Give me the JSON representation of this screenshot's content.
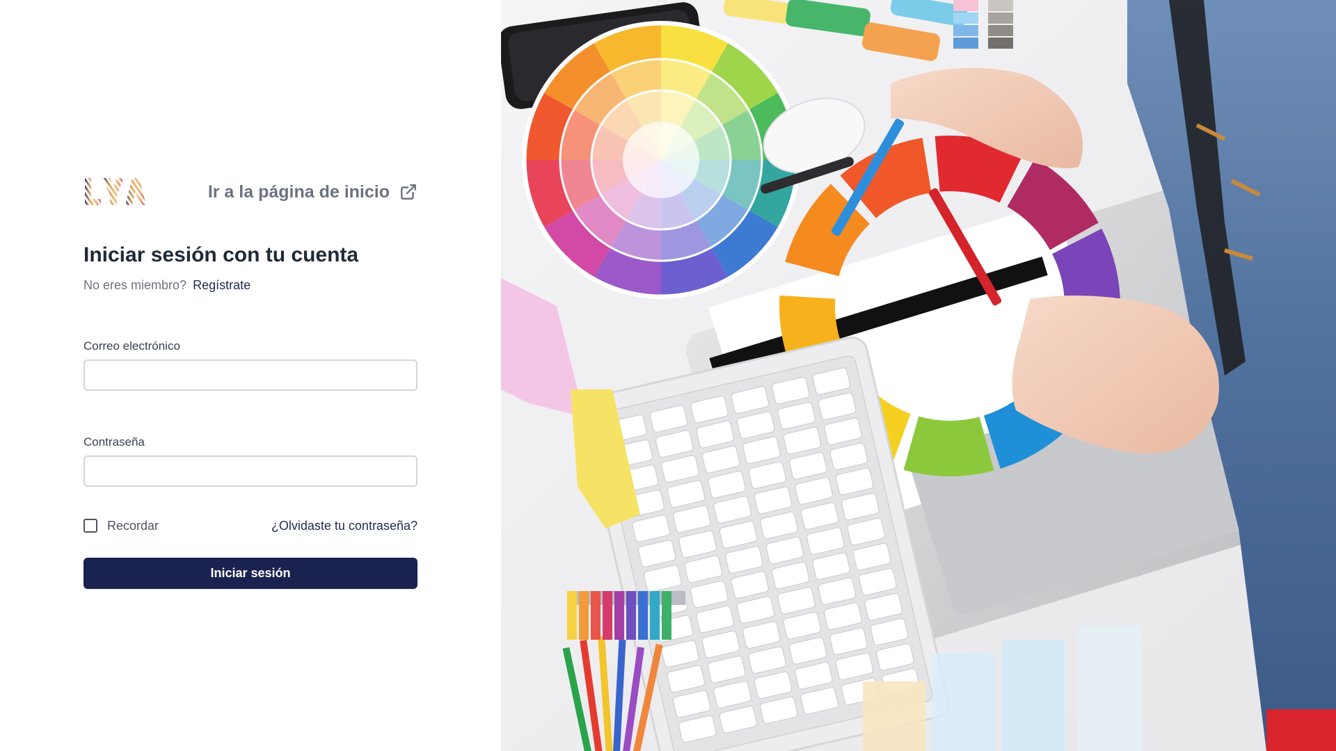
{
  "header": {
    "logo_text": "LYA",
    "home_link": "Ir a la página de inicio",
    "external_icon": "external-link-icon"
  },
  "login": {
    "title": "Iniciar sesión con tu cuenta",
    "not_member": "No eres miembro?",
    "register_link": "Regístrate",
    "email_label": "Correo electrónico",
    "email_value": "",
    "password_label": "Contraseña",
    "password_value": "",
    "remember_label": "Recordar",
    "remember_checked": false,
    "forgot_link": "¿Olvidaste tu contraseña?",
    "submit_label": "Iniciar sesión"
  },
  "hero": {
    "description_icon": "designer-desk-photo"
  },
  "colors": {
    "primary_button": "#1a2350",
    "link": "#1e2a4f",
    "muted_text": "#6b7280",
    "input_border": "#d1d5db"
  }
}
